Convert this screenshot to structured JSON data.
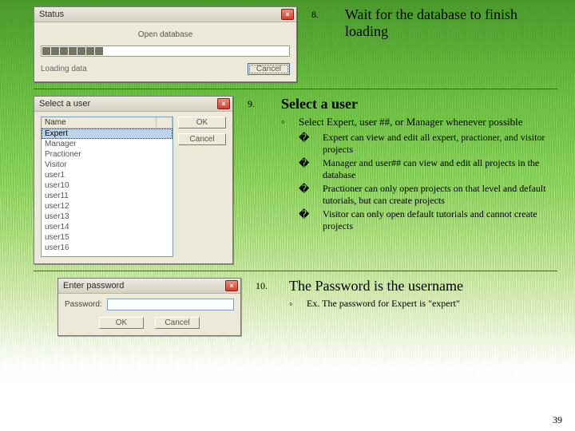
{
  "page_number": "39",
  "dialogs": {
    "progress": {
      "title": "Status",
      "label": "Open database",
      "status": "Loading data",
      "cancel": "Cancel"
    },
    "select_user": {
      "title": "Select a user",
      "col_name": "Name",
      "ok": "OK",
      "cancel": "Cancel",
      "items": [
        "Expert",
        "Manager",
        "Practioner",
        "Visitor",
        "user1",
        "user10",
        "user11",
        "user12",
        "user13",
        "user14",
        "user15",
        "user16"
      ]
    },
    "password": {
      "title": "Enter password",
      "label": "Password:",
      "ok": "OK",
      "cancel": "Cancel"
    }
  },
  "steps": {
    "s8": {
      "num": "8.",
      "title": "Wait for the database to finish loading"
    },
    "s9": {
      "num": "9.",
      "title": "Select a user",
      "sub_mark": "◦",
      "sub": "Select Expert, user ##, or Manager whenever possible",
      "bullets": [
        "Expert can view and edit all expert, practioner, and visitor projects",
        "Manager and user## can view and edit all projects in the database",
        "Practioner can only open projects on that level and default tutorials, but can create projects",
        "Visitor can only open default tutorials and cannot create projects"
      ],
      "box": "�"
    },
    "s10": {
      "num": "10.",
      "title": "The Password is the username",
      "sub_mark": "◦",
      "sub": "Ex. The password for Expert is \"expert\""
    }
  }
}
